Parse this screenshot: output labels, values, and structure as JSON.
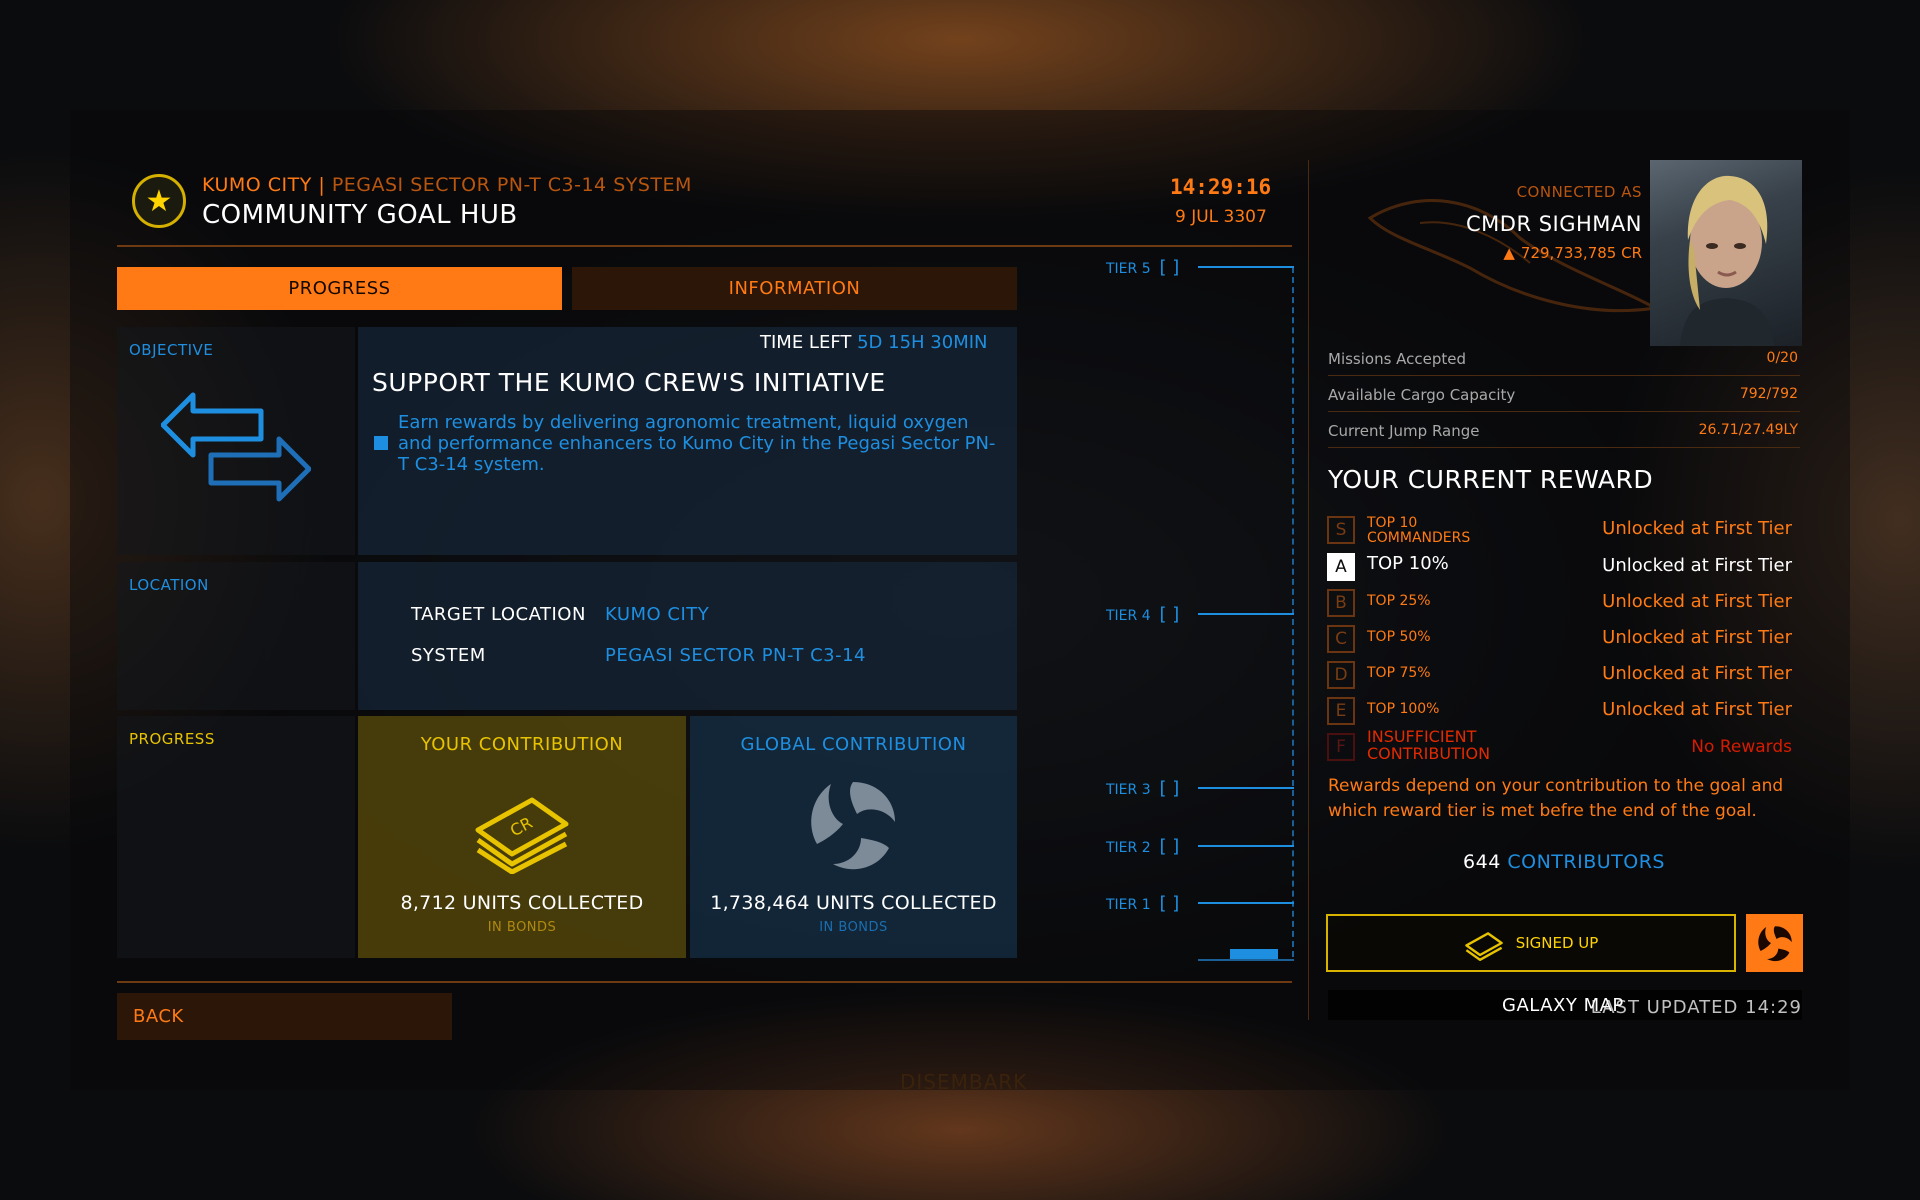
{
  "header": {
    "location_name": "KUMO CITY",
    "separator": " | ",
    "system_name": "PEGASI SECTOR PN-T C3-14 SYSTEM",
    "title": "COMMUNITY GOAL HUB",
    "time": "14:29:16",
    "date": "9 JUL 3307"
  },
  "tabs": [
    {
      "label": "PROGRESS",
      "active": true
    },
    {
      "label": "INFORMATION",
      "active": false
    }
  ],
  "sections": {
    "objective_label": "OBJECTIVE",
    "location_label": "LOCATION",
    "progress_label": "PROGRESS"
  },
  "objective": {
    "time_left_label": "TIME LEFT",
    "time_left_value": "5D 15H 30MIN",
    "title": "SUPPORT THE KUMO CREW'S INITIATIVE",
    "description": "Earn rewards by delivering agronomic treatment, liquid oxygen and performance enhancers to Kumo City in the Pegasi Sector PN-T C3-14 system."
  },
  "location": {
    "target_label": "TARGET LOCATION",
    "target_value": "KUMO CITY",
    "system_label": "SYSTEM",
    "system_value": "PEGASI SECTOR PN-T C3-14"
  },
  "contribution": {
    "yours": {
      "title": "YOUR CONTRIBUTION",
      "units": "8,712 UNITS COLLECTED",
      "sub": "IN BONDS"
    },
    "global": {
      "title": "GLOBAL CONTRIBUTION",
      "units": "1,738,464 UNITS COLLECTED",
      "sub": "IN BONDS"
    }
  },
  "tiers": [
    "TIER 5",
    "TIER 4",
    "TIER 3",
    "TIER 2",
    "TIER 1"
  ],
  "tier_bracket": "[ ]",
  "tier_progress_fraction": 0.02,
  "back_label": "BACK",
  "commander": {
    "connected_as": "CONNECTED AS",
    "name": "CMDR SIGHMAN",
    "credits": "729,733,785 CR"
  },
  "stats": [
    {
      "label": "Missions Accepted",
      "value": "0/20"
    },
    {
      "label": "Available Cargo Capacity",
      "value": "792/792"
    },
    {
      "label": "Current Jump Range",
      "value": "26.71/27.49LY"
    }
  ],
  "reward": {
    "title": "YOUR CURRENT REWARD",
    "tiers": [
      {
        "letter": "S",
        "name": "TOP 10 COMMANDERS",
        "value": "Unlocked at First Tier",
        "state": "normal"
      },
      {
        "letter": "A",
        "name": "TOP 10%",
        "value": "Unlocked at First Tier",
        "state": "selected"
      },
      {
        "letter": "B",
        "name": "TOP 25%",
        "value": "Unlocked at First Tier",
        "state": "normal"
      },
      {
        "letter": "C",
        "name": "TOP 50%",
        "value": "Unlocked at First Tier",
        "state": "normal"
      },
      {
        "letter": "D",
        "name": "TOP 75%",
        "value": "Unlocked at First Tier",
        "state": "normal"
      },
      {
        "letter": "E",
        "name": "TOP 100%",
        "value": "Unlocked at First Tier",
        "state": "normal"
      },
      {
        "letter": "F",
        "name": "INSUFFICIENT CONTRIBUTION",
        "value": "No Rewards",
        "state": "red"
      }
    ],
    "note": "Rewards depend on your contribution to the goal and which reward tier is met befre the end of the goal."
  },
  "contributors": {
    "count": "644",
    "label": "CONTRIBUTORS"
  },
  "signed_up_label": "SIGNED UP",
  "galaxy_map_label": "GALAXY MAP",
  "last_updated": "LAST UPDATED 14:29",
  "disembark_label": "DISEMBARK",
  "colors": {
    "accent": "#ff7a14",
    "blue": "#1e8fe0",
    "yellow": "#e7c300",
    "red": "#e22a00"
  }
}
